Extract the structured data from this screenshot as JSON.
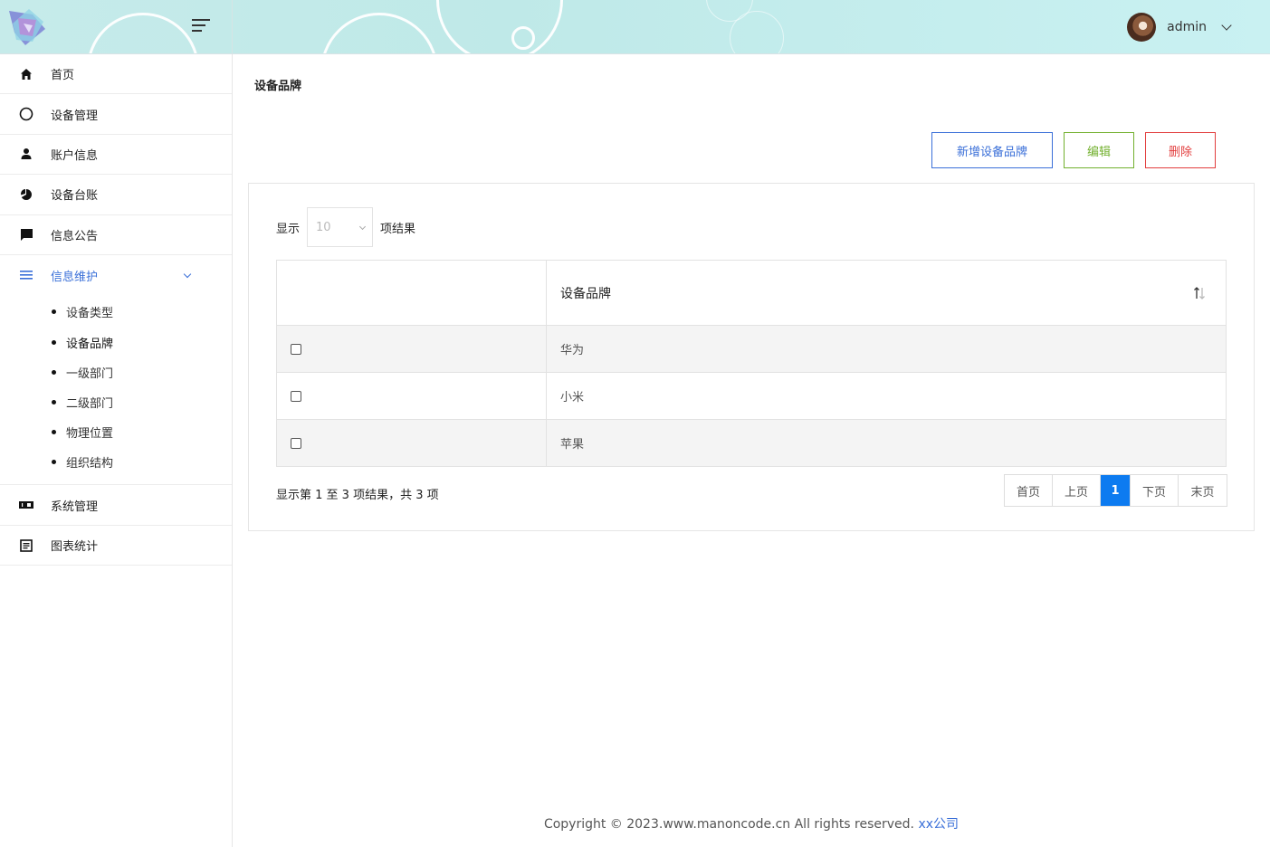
{
  "header": {
    "user_name": "admin",
    "avatar_icon": "user-avatar"
  },
  "sidebar": {
    "items": [
      {
        "label": "首页",
        "icon": "home-icon"
      },
      {
        "label": "设备管理",
        "icon": "circle-icon"
      },
      {
        "label": "账户信息",
        "icon": "person-icon"
      },
      {
        "label": "设备台账",
        "icon": "pie-chart-icon"
      },
      {
        "label": "信息公告",
        "icon": "message-icon"
      },
      {
        "label": "信息维护",
        "icon": "list-icon",
        "expanded": true
      },
      {
        "label": "系统管理",
        "icon": "ticket-icon"
      },
      {
        "label": "图表统计",
        "icon": "document-icon"
      }
    ],
    "submenu": [
      "设备类型",
      "设备品牌",
      "一级部门",
      "二级部门",
      "物理位置",
      "组织结构"
    ],
    "active_sub": "设备品牌",
    "accent_color": "#3a6fd8"
  },
  "main": {
    "title": "设备品牌",
    "buttons": {
      "add": "新增设备品牌",
      "edit": "编辑",
      "delete": "删除"
    },
    "length": {
      "prefix": "显示",
      "value": "10",
      "suffix": "项结果"
    },
    "table": {
      "columns": [
        "",
        "设备品牌"
      ],
      "rows": [
        "华为",
        "小米",
        "苹果"
      ]
    },
    "info": "显示第 1 至 3 项结果，共 3 项",
    "pager": [
      "首页",
      "上页",
      "1",
      "下页",
      "末页"
    ],
    "current_page": "1"
  },
  "footer": {
    "copyright": "Copyright © 2023.www.manoncode.cn All rights reserved. ",
    "company": "xx公司"
  }
}
